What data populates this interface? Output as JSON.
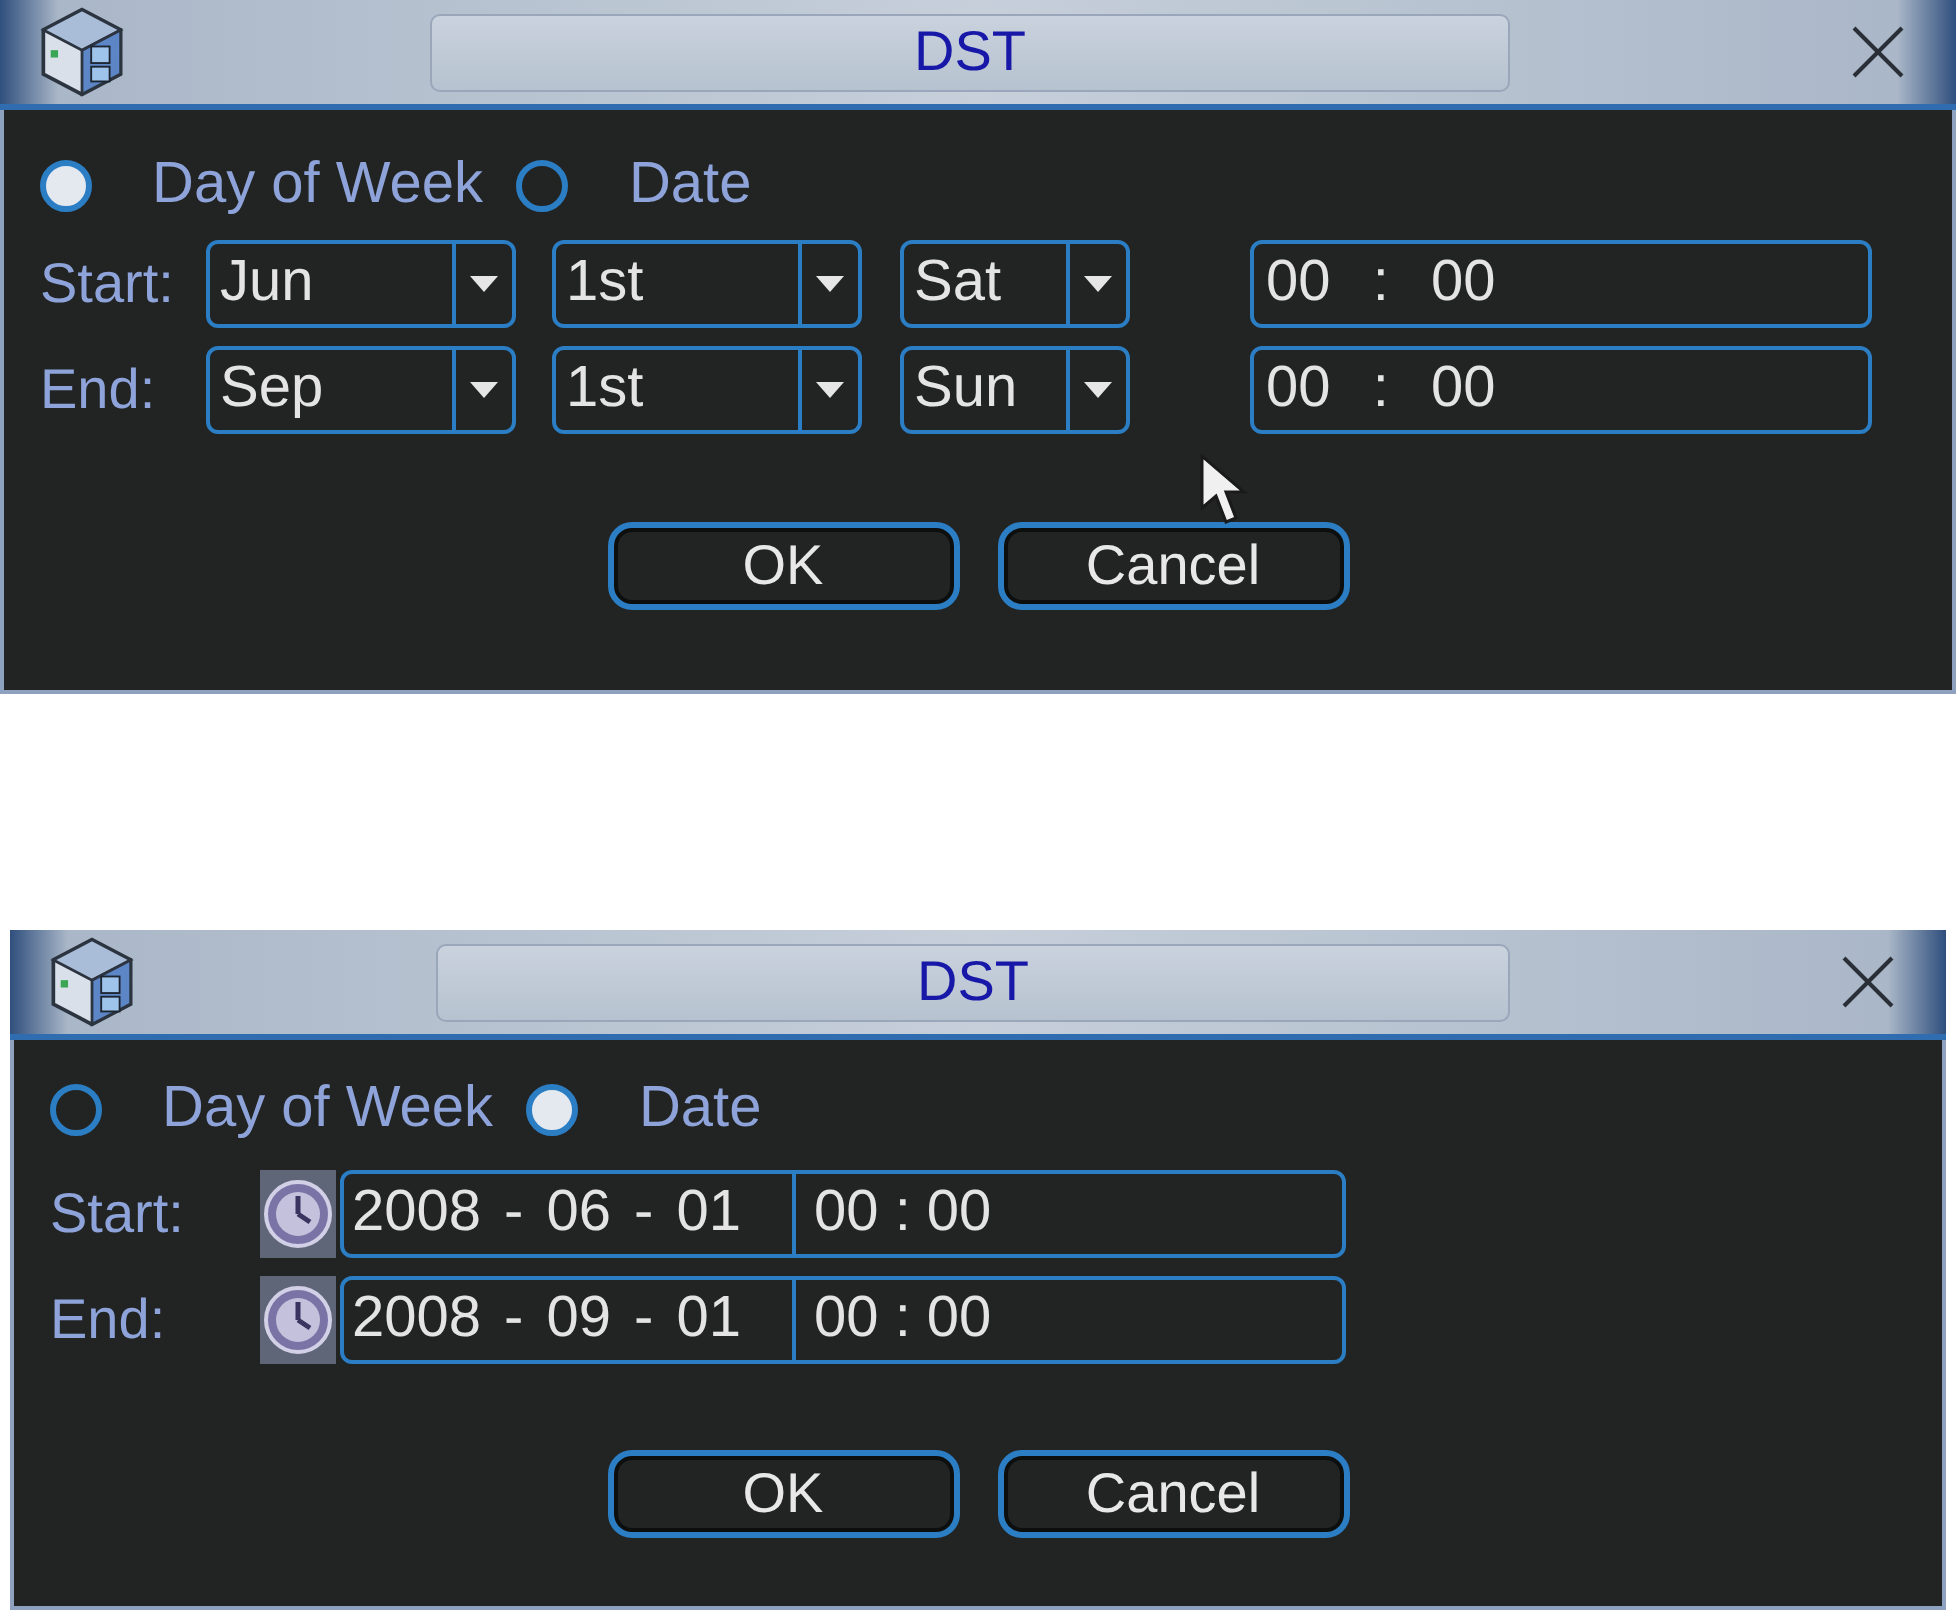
{
  "dialogs": [
    {
      "title": "DST",
      "pointer_visible": true,
      "modes": [
        {
          "label": "Day of Week",
          "selected": true
        },
        {
          "label": "Date",
          "selected": false
        }
      ],
      "rows": [
        {
          "kind": "weekday",
          "label": "Start:",
          "selects": [
            "Jun",
            "1st",
            "Sat"
          ],
          "time": "00 : 00"
        },
        {
          "kind": "weekday",
          "label": "End:",
          "selects": [
            "Sep",
            "1st",
            "Sun"
          ],
          "time": "00 : 00"
        }
      ],
      "buttons": [
        "OK",
        "Cancel"
      ]
    },
    {
      "title": "DST",
      "pointer_visible": false,
      "modes": [
        {
          "label": "Day of Week",
          "selected": false
        },
        {
          "label": "Date",
          "selected": true
        }
      ],
      "rows": [
        {
          "kind": "date",
          "label": "Start:",
          "date": "2008 - 06 - 01",
          "time": "00 : 00"
        },
        {
          "kind": "date",
          "label": "End:",
          "date": "2008 - 09 - 01",
          "time": "00 : 00"
        }
      ],
      "buttons": [
        "OK",
        "Cancel"
      ]
    }
  ]
}
